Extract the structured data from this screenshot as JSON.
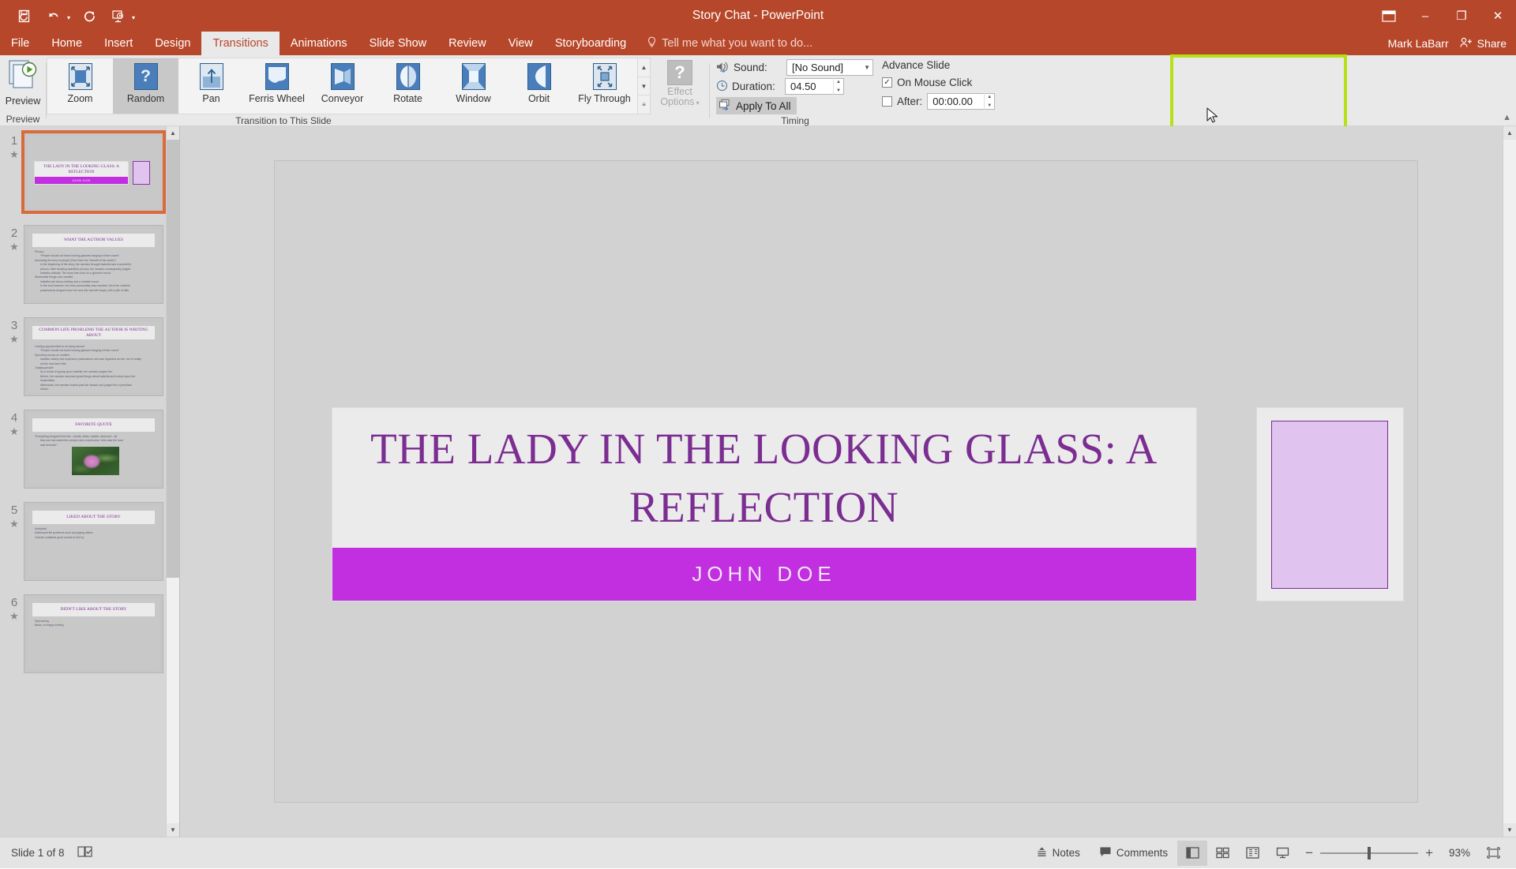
{
  "window": {
    "title": "Story Chat - PowerPoint",
    "account": "Mark LaBarr",
    "share_label": "Share",
    "quick_access": [
      "save-icon",
      "undo-icon",
      "redo-icon",
      "start-slideshow-icon",
      "customize-qat-icon"
    ],
    "controls": {
      "ribbon_display": "ribbon-display-options-icon",
      "minimize": "–",
      "maximize": "❐",
      "close": "✕"
    }
  },
  "tabs": [
    {
      "label": "File",
      "active": false
    },
    {
      "label": "Home",
      "active": false
    },
    {
      "label": "Insert",
      "active": false
    },
    {
      "label": "Design",
      "active": false
    },
    {
      "label": "Transitions",
      "active": true
    },
    {
      "label": "Animations",
      "active": false
    },
    {
      "label": "Slide Show",
      "active": false
    },
    {
      "label": "Review",
      "active": false
    },
    {
      "label": "View",
      "active": false
    },
    {
      "label": "Storyboarding",
      "active": false
    }
  ],
  "tellme": {
    "placeholder": "Tell me what you want to do...",
    "icon": "lightbulb-icon"
  },
  "ribbon": {
    "preview": {
      "label": "Preview",
      "group_label": "Preview",
      "icon": "preview-play-icon"
    },
    "transition_group_label": "Transition to This Slide",
    "transitions": [
      {
        "label": "Zoom",
        "icon": "zoom-transition-icon",
        "selected": false
      },
      {
        "label": "Random",
        "icon": "random-transition-icon",
        "selected": true
      },
      {
        "label": "Pan",
        "icon": "pan-transition-icon",
        "selected": false
      },
      {
        "label": "Ferris Wheel",
        "icon": "ferris-wheel-transition-icon",
        "selected": false
      },
      {
        "label": "Conveyor",
        "icon": "conveyor-transition-icon",
        "selected": false
      },
      {
        "label": "Rotate",
        "icon": "rotate-transition-icon",
        "selected": false
      },
      {
        "label": "Window",
        "icon": "window-transition-icon",
        "selected": false
      },
      {
        "label": "Orbit",
        "icon": "orbit-transition-icon",
        "selected": false
      },
      {
        "label": "Fly Through",
        "icon": "fly-through-transition-icon",
        "selected": false
      }
    ],
    "effect_options": {
      "line1": "Effect",
      "line2": "Options",
      "icon": "question-mark-icon",
      "disabled": true
    },
    "timing": {
      "group_label": "Timing",
      "sound_label": "Sound:",
      "sound_value": "[No Sound]",
      "sound_icon": "speaker-icon",
      "duration_label": "Duration:",
      "duration_value": "04.50",
      "duration_icon": "clock-icon",
      "apply_to_all_label": "Apply To All",
      "apply_to_all_icon": "apply-all-icon",
      "highlight_color": "#b7e017"
    },
    "advance_slide": {
      "title": "Advance Slide",
      "on_mouse_click_label": "On Mouse Click",
      "on_mouse_click_checked": true,
      "after_label": "After:",
      "after_value": "00:00.00",
      "after_checked": false
    }
  },
  "slides": [
    {
      "number": "1",
      "active": true,
      "type": "title",
      "title": "THE LADY IN THE LOOKING GLASS: A REFLECTION",
      "subtitle": "JOHN DOE"
    },
    {
      "number": "2",
      "active": false,
      "type": "content",
      "title": "WHAT THE AUTHOR VALUES",
      "bullets": [
        {
          "level": 1,
          "text": "Privacy"
        },
        {
          "level": 2,
          "text": "“People should not leave looking glasses hanging in their rooms”"
        },
        {
          "level": 1,
          "text": "Assuming the best of people (Give them the “benefit of the doubt”)"
        },
        {
          "level": 2,
          "text": "In the beginning of the story, the narrator thought Isabella was a wonderful"
        },
        {
          "level": 2,
          "text": "person. After invading Isabella's privacy, the narrator consequently judged"
        },
        {
          "level": 2,
          "text": "Isabella critically. The story then took on a gloomier mood."
        },
        {
          "level": 1,
          "text": "Worthwhile things over vanities"
        },
        {
          "level": 2,
          "text": "Isabella had fancy clothing and a notable house."
        },
        {
          "level": 2,
          "text": "In the end however, her inner personality was revealed. All of her material"
        },
        {
          "level": 2,
          "text": "possessions dropped from her and she was left empty, with a pile of bills"
        }
      ]
    },
    {
      "number": "3",
      "active": false,
      "type": "content",
      "title": "COMMON LIFE PROBLEMS THE AUTHOR IS WRITING ABOUT",
      "bullets": [
        {
          "level": 1,
          "text": "Leaving opportunities to sin lying around"
        },
        {
          "level": 2,
          "text": "“People should not leave looking glasses hanging in their rooms”"
        },
        {
          "level": 1,
          "text": "Spending money on vanities"
        },
        {
          "level": 2,
          "text": "Isabella clearly had expensive possessions and was regarded as rich, but in reality"
        },
        {
          "level": 2,
          "text": "all she had were bills."
        },
        {
          "level": 1,
          "text": "Judging people"
        },
        {
          "level": 2,
          "text": "As a result of spying upon Isabella, the narrator judged her."
        },
        {
          "level": 2,
          "text": "Before, the narrator assumed great things about Isabella and looked upon her"
        },
        {
          "level": 2,
          "text": "respectably."
        },
        {
          "level": 2,
          "text": "Afterwards, the narrator looked past her facade and judged her a penniless"
        },
        {
          "level": 2,
          "text": "debtor."
        }
      ]
    },
    {
      "number": "4",
      "active": false,
      "type": "quote",
      "title": "FAVORITE QUOTE",
      "bullets": [
        {
          "level": 1,
          "text": "“Everything dropped from her– clouds, dress, basket, diamond – all"
        },
        {
          "level": 2,
          "text": "that one had called the creeper and convolvulus. Here was the hard"
        },
        {
          "level": 2,
          "text": "wall beneath.”"
        }
      ],
      "image": "pink-flower-photo"
    },
    {
      "number": "5",
      "active": false,
      "type": "content",
      "title": "LIKED ABOUT THE STORY",
      "bullets": [
        {
          "level": 1,
          "text": "Analytical"
        },
        {
          "level": 1,
          "text": "Addressed life problems such as judging others"
        },
        {
          "level": 1,
          "text": "Overall contained good morals to live by"
        }
      ]
    },
    {
      "number": "6",
      "active": false,
      "type": "content",
      "title": "DIDN'T LIKE ABOUT THE STORY",
      "bullets": [
        {
          "level": 1,
          "text": "Depressing"
        },
        {
          "level": 1,
          "text": "Basic, no happy ending"
        }
      ]
    }
  ],
  "main_slide": {
    "title": "THE LADY IN THE LOOKING GLASS: A REFLECTION",
    "subtitle": "JOHN DOE",
    "title_color": "#7b2d91",
    "accent_color": "#c12fe0",
    "rect_fill": "#e0c3ee"
  },
  "status_bar": {
    "slide_counter": "Slide 1 of 8",
    "accessibility_icon": "accessibility-checker-icon",
    "notes_label": "Notes",
    "notes_icon": "notes-icon",
    "comments_label": "Comments",
    "comments_icon": "comments-icon",
    "views": [
      {
        "name": "normal-view",
        "active": true
      },
      {
        "name": "slide-sorter-view",
        "active": false
      },
      {
        "name": "reading-view",
        "active": false
      },
      {
        "name": "slide-show-view",
        "active": false
      }
    ],
    "zoom_out": "−",
    "zoom_in": "+",
    "zoom_level": "93%",
    "fit_to_window_icon": "fit-slide-icon"
  }
}
